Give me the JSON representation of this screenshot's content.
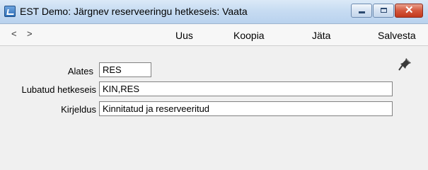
{
  "window": {
    "title": "EST Demo: Järgnev reserveeringu hetkeseis: Vaata",
    "controls": {
      "minimize_icon": "minimize-icon",
      "maximize_icon": "maximize-icon",
      "close_glyph": "✕"
    }
  },
  "toolbar": {
    "prev": "<",
    "next": ">",
    "buttons": {
      "uus": "Uus",
      "koopia": "Koopia",
      "jata": "Jäta",
      "salvesta": "Salvesta"
    }
  },
  "form": {
    "alates": {
      "label": "Alates",
      "value": "RES"
    },
    "lubatud": {
      "label": "Lubatud hetkeseis",
      "value": "KIN,RES"
    },
    "kirjeldus": {
      "label": "Kirjeldus",
      "value": "Kinnitatud ja reserveeritud"
    }
  },
  "icons": {
    "pin": "pin-icon"
  },
  "colors": {
    "titlebar": "#c7dcf2",
    "close_button": "#c2391c",
    "background": "#f0f0f0"
  }
}
